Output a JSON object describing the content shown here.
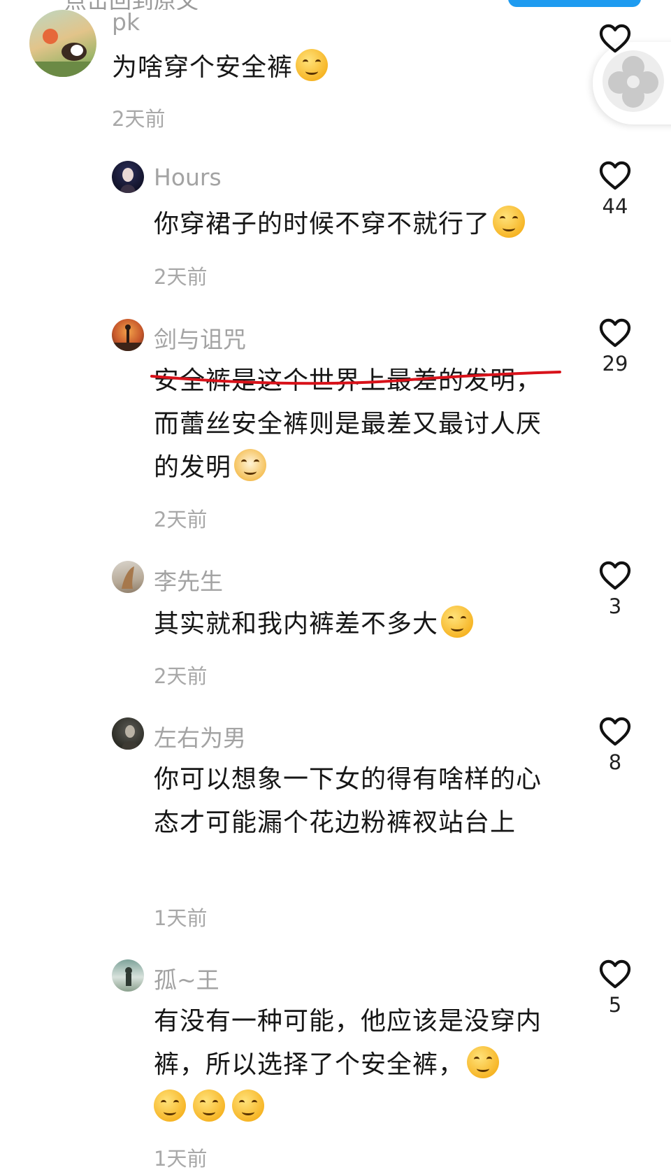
{
  "header": {
    "back_link": "点击回到原文"
  },
  "comments": [
    {
      "username": "pk",
      "text": "为啥穿个安全裤",
      "emoji": "crying-laughing-emoji",
      "time": "2天前",
      "likes": ""
    },
    {
      "username": "Hours",
      "text": "你穿裙子的时候不穿不就行了",
      "emoji": "upside-down-face-emoji",
      "time": "2天前",
      "likes": "44"
    },
    {
      "username": "剑与诅咒",
      "text_line1": "安全裤是这个世界上最差的发明",
      "text_rest": "，而蕾丝安全裤则是最差又最讨人厌的发明",
      "emoji": "shiba-dog-emoji",
      "time": "2天前",
      "likes": "29"
    },
    {
      "username": "李先生",
      "text": "其实就和我内裤差不多大",
      "emoji": "laughing-tears-emoji",
      "time": "2天前",
      "likes": "3"
    },
    {
      "username": "左右为男",
      "text": "你可以想象一下女的得有啥样的心态才可能漏个花边粉裤衩站台上",
      "time": "1天前",
      "likes": "8"
    },
    {
      "username": "孤~王",
      "text": "有没有一种可能，他应该是没穿内裤，所以选择了个安全裤，",
      "emoji": "smirk-emoji",
      "time": "1天前",
      "likes": "5"
    }
  ],
  "colors": {
    "underline": "#d8121a",
    "accent_button": "#1e9bf0",
    "meta_text": "#a3a3a3"
  },
  "icons": {
    "like": "heart-outline-icon",
    "float": "pinwheel-icon"
  }
}
